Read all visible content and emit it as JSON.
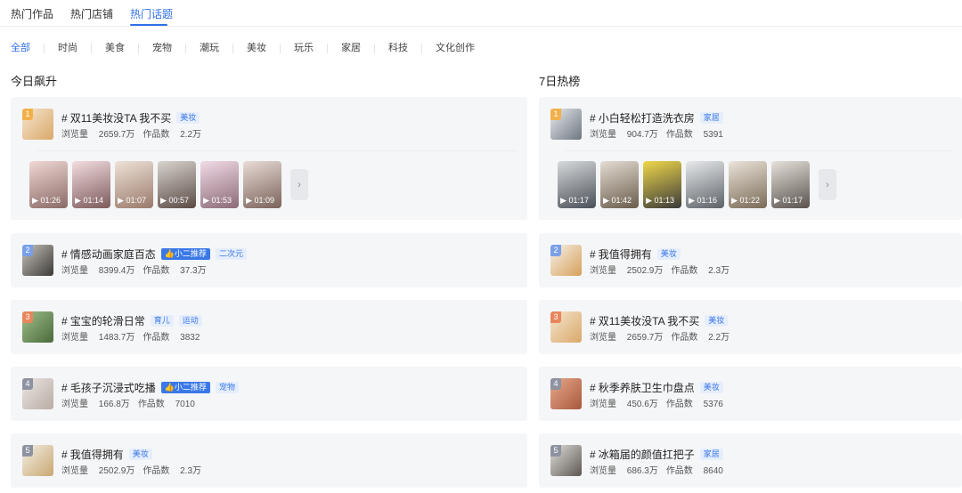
{
  "tabs": [
    {
      "label": "热门作品"
    },
    {
      "label": "热门店铺"
    },
    {
      "label": "热门话题",
      "active": true
    }
  ],
  "categories": [
    "全部",
    "时尚",
    "美食",
    "宠物",
    "潮玩",
    "美妆",
    "玩乐",
    "家居",
    "科技",
    "文化创作"
  ],
  "left": {
    "heading": "今日飙升",
    "featured": {
      "rank": "1",
      "title": "双11美妆没TA 我不买",
      "tag": "美妆",
      "views_label": "浏览量",
      "views": "2659.7万",
      "works_label": "作品数",
      "works": "2.2万",
      "videos": [
        "01:26",
        "01:14",
        "01:07",
        "00:57",
        "01:53",
        "01:09"
      ]
    },
    "items": [
      {
        "rank": "2",
        "title": "情感动画家庭百态",
        "badge": "小二推荐",
        "tag": "二次元",
        "views_label": "浏览量",
        "views": "8399.4万",
        "works_label": "作品数",
        "works": "37.3万"
      },
      {
        "rank": "3",
        "title": "宝宝的轮滑日常",
        "tag": "育儿",
        "tag2": "运动",
        "views_label": "浏览量",
        "views": "1483.7万",
        "works_label": "作品数",
        "works": "3832"
      },
      {
        "rank": "4",
        "title": "毛孩子沉浸式吃播",
        "badge": "小二推荐",
        "tag": "宠物",
        "views_label": "浏览量",
        "views": "166.8万",
        "works_label": "作品数",
        "works": "7010"
      },
      {
        "rank": "5",
        "title": "我值得拥有",
        "tag": "美妆",
        "views_label": "浏览量",
        "views": "2502.9万",
        "works_label": "作品数",
        "works": "2.3万"
      }
    ]
  },
  "right": {
    "heading": "7日热榜",
    "featured": {
      "rank": "1",
      "title": "小白轻松打造洗衣房",
      "tag": "家居",
      "views_label": "浏览量",
      "views": "904.7万",
      "works_label": "作品数",
      "works": "5391",
      "videos": [
        "01:17",
        "01:42",
        "01:13",
        "01:16",
        "01:22",
        "01:17"
      ]
    },
    "items": [
      {
        "rank": "2",
        "title": "我值得拥有",
        "tag": "美妆",
        "views_label": "浏览量",
        "views": "2502.9万",
        "works_label": "作品数",
        "works": "2.3万"
      },
      {
        "rank": "3",
        "title": "双11美妆没TA 我不买",
        "tag": "美妆",
        "views_label": "浏览量",
        "views": "2659.7万",
        "works_label": "作品数",
        "works": "2.2万"
      },
      {
        "rank": "4",
        "title": "秋季养肤卫生巾盘点",
        "tag": "美妆",
        "views_label": "浏览量",
        "views": "450.6万",
        "works_label": "作品数",
        "works": "5376"
      },
      {
        "rank": "5",
        "title": "冰箱届的颜值扛把子",
        "tag": "家居",
        "views_label": "浏览量",
        "views": "686.3万",
        "works_label": "作品数",
        "works": "8640"
      }
    ]
  },
  "icons": {
    "hash": "#",
    "play": "▶",
    "thumb_up": "👍",
    "next": "›"
  }
}
